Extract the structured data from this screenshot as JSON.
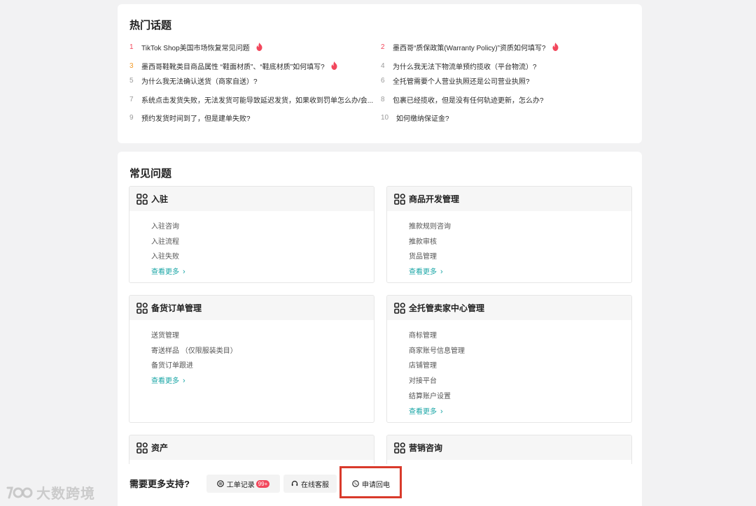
{
  "hot_topics": {
    "title": "热门话题",
    "items": [
      {
        "num": "1",
        "text": "TikTok Shop美国市场恢复常见问题",
        "hot": true
      },
      {
        "num": "2",
        "text": "墨西哥“质保政策(Warranty Policy)”资质如何填写?",
        "hot": true
      },
      {
        "num": "3",
        "text": "墨西哥鞋靴类目商品属性 “鞋面材质”、“鞋底材质”如何填写?",
        "hot": true
      },
      {
        "num": "4",
        "text": "为什么我无法下物流单预约揽收（平台物流）?",
        "hot": false
      },
      {
        "num": "5",
        "text": "为什么我无法确认送货（商家自送）?",
        "hot": false
      },
      {
        "num": "6",
        "text": "全托管需要个人营业执照还是公司营业执照?",
        "hot": false
      },
      {
        "num": "7",
        "text": "系统点击发货失败，无法发货可能导致延迟发货，如果收到罚单怎么办/会...",
        "hot": false
      },
      {
        "num": "8",
        "text": "包裹已经揽收，但是没有任何轨迹更新，怎么办?",
        "hot": false
      },
      {
        "num": "9",
        "text": "预约发货时间到了，但是建单失败?",
        "hot": false
      },
      {
        "num": "10",
        "text": "如何缴纳保证金?",
        "hot": false
      }
    ]
  },
  "faq": {
    "title": "常见问题",
    "view_more": "查看更多",
    "categories": [
      {
        "title": "入驻",
        "links": [
          "入驻咨询",
          "入驻流程",
          "入驻失败"
        ]
      },
      {
        "title": "商品开发管理",
        "links": [
          "推款规则咨询",
          "推款审核",
          "货品管理"
        ]
      },
      {
        "title": "备货订单管理",
        "links": [
          "送货管理",
          "寄送样品 （仅限服装类目）",
          "备货订单跟进"
        ]
      },
      {
        "title": "全托管卖家中心管理",
        "links": [
          "商标管理",
          "商家账号信息管理",
          "店铺管理",
          "对接平台",
          "结算账户设置"
        ]
      },
      {
        "title": "资产",
        "links": []
      },
      {
        "title": "营销咨询",
        "links": []
      }
    ]
  },
  "support": {
    "label": "需要更多支持?",
    "ticket_label": "工单记录",
    "ticket_badge": "99+",
    "online_label": "在线客服",
    "callback_label": "申请回电"
  },
  "watermark": {
    "text": "大数跨境"
  },
  "colors": {
    "accent_teal": "#1aa6a6",
    "hot_red": "#f2475c",
    "highlight_red": "#d93a2b"
  }
}
